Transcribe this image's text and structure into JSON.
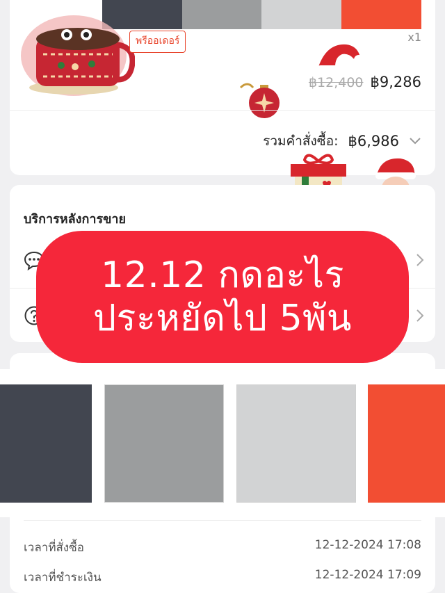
{
  "palette": {
    "colors": [
      "#424650",
      "#9b9d9e",
      "#d2d3d4",
      "#f24e33"
    ]
  },
  "order_item": {
    "preorder_badge": "พรีออเดอร์",
    "quantity": "x1",
    "original_price": "฿12,400",
    "price": "฿9,286"
  },
  "order_total": {
    "label": "รวมคำสั่งซื้อ:",
    "value": "฿6,986",
    "expand_icon": "chevron-down-icon"
  },
  "after_sales": {
    "title": "บริการหลังการขาย",
    "rows": [
      {
        "icon": "chat-bubble-icon",
        "chevron": "chevron-right-icon"
      },
      {
        "icon": "question-icon",
        "chevron": "chevron-right-icon"
      }
    ]
  },
  "banner": {
    "line1": "12.12 กดอะไร",
    "line2": "ประหยัดไป 5พัน",
    "color": "#f5273a"
  },
  "order_times": [
    {
      "label": "เวลาที่สั่งซื้อ",
      "value": "12-12-2024 17:08"
    },
    {
      "label": "เวลาที่ชำระเงิน",
      "value": "12-12-2024 17:09"
    }
  ],
  "decorations": [
    "mug-sticker",
    "santa-hat-sticker",
    "ornament-sticker",
    "gift-box-sticker",
    "santa-face-sticker"
  ]
}
